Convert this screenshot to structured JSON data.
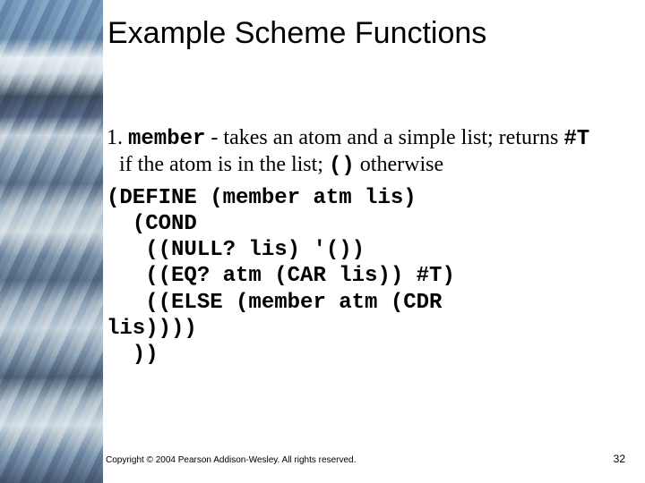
{
  "title": "Example Scheme Functions",
  "item": {
    "num": "1.",
    "name": "member",
    "desc_before": " - takes an atom and a simple list; returns ",
    "ret_true": "#T",
    "desc_mid": " if the atom is in the list; ",
    "ret_false": "()",
    "desc_after": " otherwise"
  },
  "code": "(DEFINE (member atm lis)\n  (COND\n   ((NULL? lis) '())\n   ((EQ? atm (CAR lis)) #T)\n   ((ELSE (member atm (CDR\nlis))))\n  ))",
  "copyright": "Copyright © 2004 Pearson Addison-Wesley. All rights reserved.",
  "page": "32"
}
